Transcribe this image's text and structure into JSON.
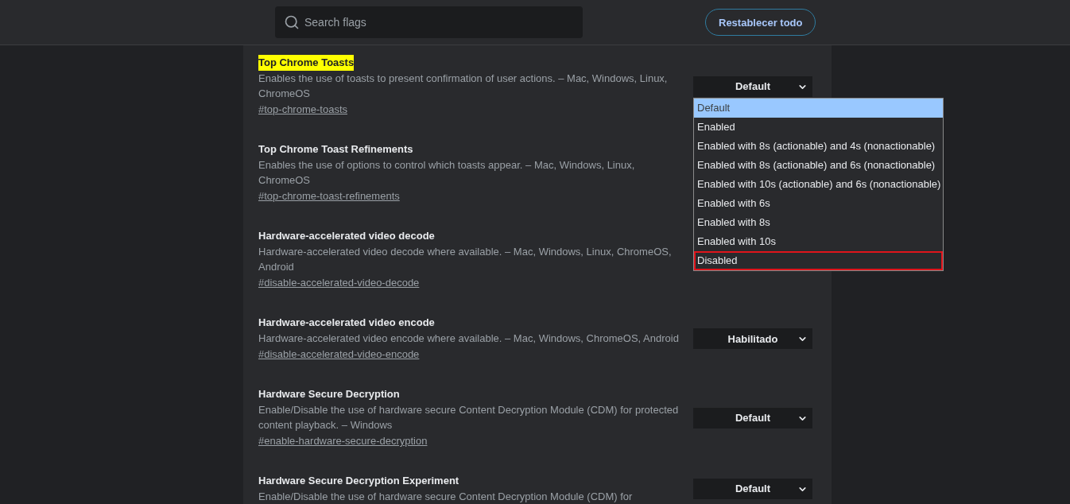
{
  "search": {
    "placeholder": "Search flags"
  },
  "reset_button": {
    "label": "Restablecer todo"
  },
  "flags": [
    {
      "title": "Top Chrome Toasts",
      "highlighted": true,
      "description": "Enables the use of toasts to present confirmation of user actions. – Mac, Windows, Linux, ChromeOS",
      "link": "#top-chrome-toasts",
      "select": {
        "value": "Default",
        "options": [
          {
            "label": "Default",
            "selected": true,
            "outlined": false
          },
          {
            "label": "Enabled",
            "selected": false,
            "outlined": false
          },
          {
            "label": "Enabled with 8s (actionable) and 4s (nonactionable)",
            "selected": false,
            "outlined": false
          },
          {
            "label": "Enabled with 8s (actionable) and 6s (nonactionable)",
            "selected": false,
            "outlined": false
          },
          {
            "label": "Enabled with 10s (actionable) and 6s (nonactionable)",
            "selected": false,
            "outlined": false
          },
          {
            "label": "Enabled with 6s",
            "selected": false,
            "outlined": false
          },
          {
            "label": "Enabled with 8s",
            "selected": false,
            "outlined": false
          },
          {
            "label": "Enabled with 10s",
            "selected": false,
            "outlined": false
          },
          {
            "label": "Disabled",
            "selected": false,
            "outlined": true
          }
        ]
      }
    },
    {
      "title": "Top Chrome Toast Refinements",
      "highlighted": false,
      "description": "Enables the use of options to control which toasts appear. – Mac, Windows, Linux, ChromeOS",
      "link": "#top-chrome-toast-refinements"
    },
    {
      "title": "Hardware-accelerated video decode",
      "highlighted": false,
      "description": "Hardware-accelerated video decode where available. – Mac, Windows, Linux, ChromeOS, Android",
      "link": "#disable-accelerated-video-decode"
    },
    {
      "title": "Hardware-accelerated video encode",
      "highlighted": false,
      "description": "Hardware-accelerated video encode where available. – Mac, Windows, ChromeOS, Android",
      "link": "#disable-accelerated-video-encode",
      "select": {
        "value": "Habilitado"
      }
    },
    {
      "title": "Hardware Secure Decryption",
      "highlighted": false,
      "description": "Enable/Disable the use of hardware secure Content Decryption Module (CDM) for protected content playback. – Windows",
      "link": "#enable-hardware-secure-decryption",
      "select": {
        "value": "Default"
      }
    },
    {
      "title": "Hardware Secure Decryption Experiment",
      "highlighted": false,
      "description": "Enable/Disable the use of hardware secure Content Decryption Module (CDM) for",
      "select": {
        "value": "Default"
      }
    }
  ]
}
